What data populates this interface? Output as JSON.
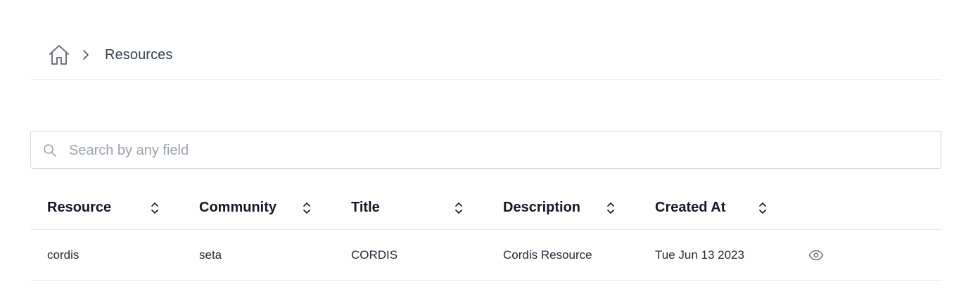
{
  "breadcrumb": {
    "home_icon": "home-icon",
    "separator_icon": "chevron-right-icon",
    "current": "Resources"
  },
  "search": {
    "placeholder": "Search by any field",
    "value": "",
    "icon": "search-icon"
  },
  "table": {
    "columns": [
      {
        "label": "Resource",
        "sort_icon": "sort-icon"
      },
      {
        "label": "Community",
        "sort_icon": "sort-icon"
      },
      {
        "label": "Title",
        "sort_icon": "sort-icon"
      },
      {
        "label": "Description",
        "sort_icon": "sort-icon"
      },
      {
        "label": "Created At",
        "sort_icon": "sort-icon"
      }
    ],
    "rows": [
      {
        "resource": "cordis",
        "community": "seta",
        "title": "CORDIS",
        "description": "Cordis Resource",
        "created_at": "Tue Jun 13 2023",
        "action_icon": "eye-icon"
      }
    ]
  },
  "colors": {
    "text_primary": "#111827",
    "text_muted": "#9ca3af",
    "border": "#e5e7eb",
    "icon": "#6b7280"
  }
}
